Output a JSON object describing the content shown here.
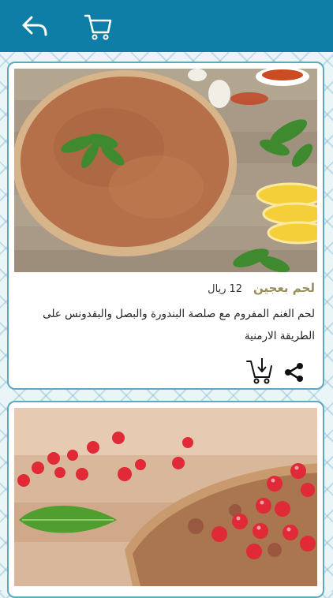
{
  "header": {
    "back_icon": "back-arrow-icon",
    "cart_icon": "cart-icon",
    "color": "#0f7ea6"
  },
  "products": [
    {
      "name": "لحم بعجين",
      "price_value": "12",
      "price_currency": "ريال",
      "description": "لحم الغنم المفروم مع صلصة البندورة والبصل والبقدونس على الطريقة الارمنية",
      "name_color": "#9a8f5a"
    },
    {}
  ],
  "actions": {
    "share_icon": "share-icon",
    "add_to_cart_icon": "cart-download-icon"
  }
}
